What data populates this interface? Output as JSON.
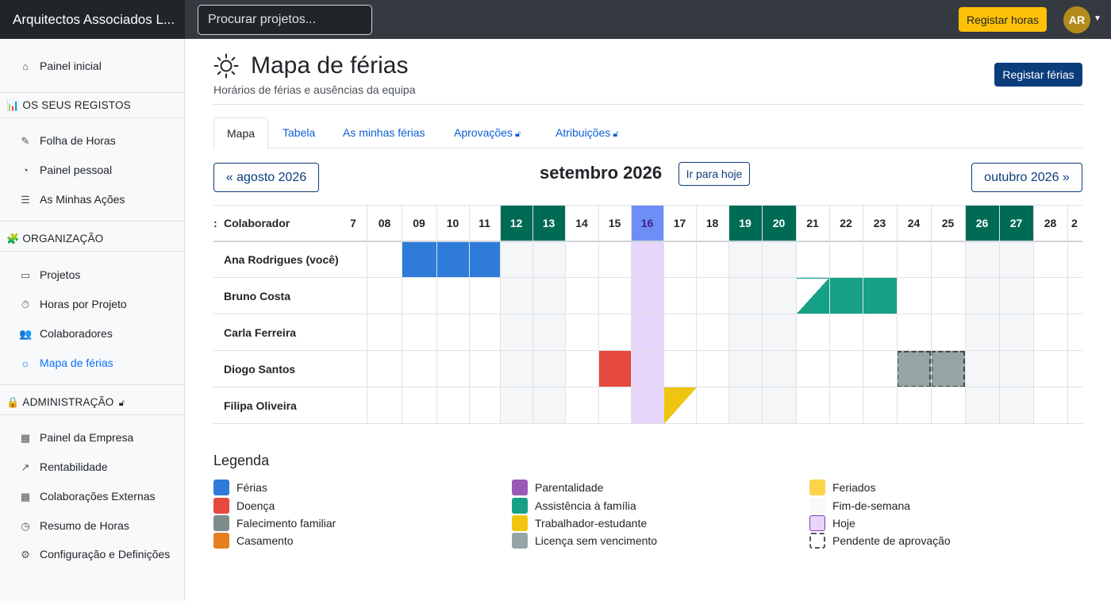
{
  "topbar": {
    "brand": "Arquitectos Associados L...",
    "search_placeholder": "Procurar projetos...",
    "register_hours": "Registar horas",
    "avatar": "AR"
  },
  "sidebar": {
    "home": "Painel inicial",
    "section_records": "OS SEUS REGISTOS",
    "timesheet": "Folha de Horas",
    "personal_panel": "Painel pessoal",
    "my_actions": "As Minhas Ações",
    "section_org": "ORGANIZAÇÃO",
    "projects": "Projetos",
    "hours_by_project": "Horas por Projeto",
    "collaborators": "Colaboradores",
    "vacation_map": "Mapa de férias",
    "section_admin": "ADMINISTRAÇÃO",
    "company_panel": "Painel da Empresa",
    "profitability": "Rentabilidade",
    "external": "Colaborações Externas",
    "hours_summary": "Resumo de Horas",
    "settings": "Configuração e Definições"
  },
  "page": {
    "title": "Mapa de férias",
    "subtitle": "Horários de férias e ausências da equipa",
    "register_vacation": "Registar férias"
  },
  "tabs": [
    "Mapa",
    "Tabela",
    "As minhas férias",
    "Aprovações",
    "Atribuições"
  ],
  "calendar": {
    "prev": "« agosto 2026",
    "month": "setembro 2026",
    "today_button": "Ir para hoje",
    "next": "outubro 2026 »",
    "collaborator_header": "Colaborador",
    "partial_first_day": "7",
    "partial_last_day": "2",
    "days": [
      "08",
      "09",
      "10",
      "11",
      "12",
      "13",
      "14",
      "15",
      "16",
      "17",
      "18",
      "19",
      "20",
      "21",
      "22",
      "23",
      "24",
      "25",
      "26",
      "27",
      "28"
    ],
    "weekend_days": [
      "12",
      "13",
      "19",
      "20",
      "26",
      "27"
    ],
    "today": "16",
    "people": [
      "Ana Rodrigues (você)",
      "Bruno Costa",
      "Carla Ferreira",
      "Diogo Santos",
      "Filipa Oliveira"
    ],
    "absences": [
      {
        "person": 0,
        "days": [
          "09",
          "10",
          "11"
        ],
        "type": "ferias",
        "shape": "full"
      },
      {
        "person": 1,
        "days": [
          "21"
        ],
        "type": "assistencia",
        "shape": "half"
      },
      {
        "person": 1,
        "days": [
          "22",
          "23"
        ],
        "type": "assistencia",
        "shape": "full"
      },
      {
        "person": 3,
        "days": [
          "15"
        ],
        "type": "doenca",
        "shape": "full"
      },
      {
        "person": 3,
        "days": [
          "24",
          "25"
        ],
        "type": "licenca",
        "shape": "pending"
      },
      {
        "person": 4,
        "days": [
          "17"
        ],
        "type": "trabalhador",
        "shape": "half-top"
      }
    ]
  },
  "legend": {
    "title": "Legenda",
    "items": [
      {
        "label": "Férias",
        "color": "#2e7bd9"
      },
      {
        "label": "Doença",
        "color": "#e5483d"
      },
      {
        "label": "Falecimento familiar",
        "color": "#7f8c8d"
      },
      {
        "label": "Casamento",
        "color": "#e67e22"
      },
      {
        "label": "Parentalidade",
        "color": "#9b59b6"
      },
      {
        "label": "Assistência à família",
        "color": "#16a085"
      },
      {
        "label": "Trabalhador-estudante",
        "color": "#f1c40f"
      },
      {
        "label": "Licença sem vencimento",
        "color": "#95a5a6"
      },
      {
        "label": "Feriados",
        "color": "#fdd34a"
      },
      {
        "label": "Fim-de-semana",
        "color": "#f8f9fa"
      },
      {
        "label": "Hoje",
        "color": "#e8d5fb"
      },
      {
        "label": "Pendente de aprovação",
        "color": "#ffffff"
      }
    ]
  },
  "colors": {
    "weekend_header": "#006b55",
    "today_header": "#6e8ef5",
    "today_column": "#e8d5fb",
    "weekend_cell": "#f4f6f8"
  }
}
